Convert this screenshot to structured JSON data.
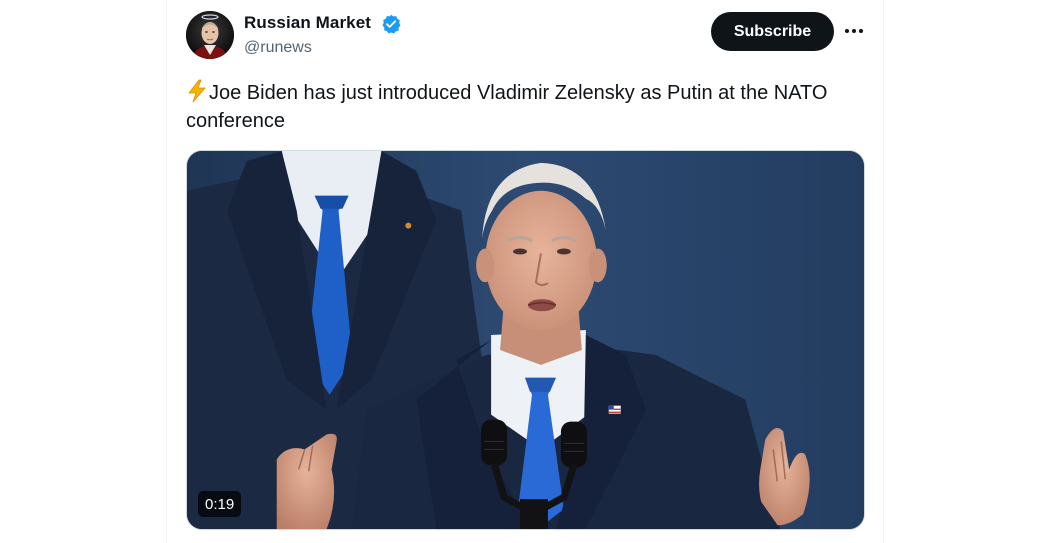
{
  "author": {
    "display_name": "Russian Market",
    "handle": "@runews",
    "verified": true,
    "avatar_icon": "profile-avatar"
  },
  "actions": {
    "subscribe_label": "Subscribe",
    "more_icon": "more-horizontal-icon"
  },
  "tweet": {
    "emoji_icon": "lightning-bolt-icon",
    "text": "Joe Biden has just introduced Vladimir Zelensky as Putin at the NATO conference"
  },
  "media": {
    "type": "video",
    "duration": "0:19"
  },
  "colors": {
    "text": "#0f1419",
    "secondary": "#536471",
    "verified": "#1d9bf0",
    "button_bg": "#0f1419",
    "video_bg": "#2a4266"
  }
}
